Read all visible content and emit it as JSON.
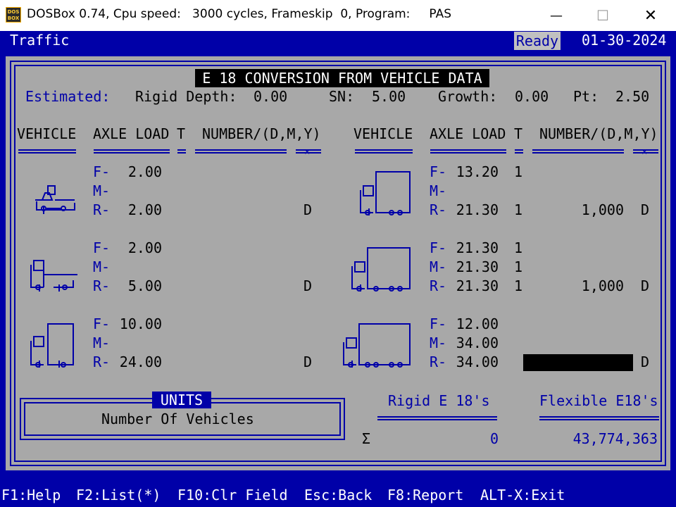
{
  "window": {
    "title": "DOSBox 0.74, Cpu speed:   3000 cycles, Frameskip  0, Program:     PAS",
    "icon_text": "DOS BOX",
    "minimize": "—",
    "maximize": "☐",
    "close": "✕"
  },
  "header": {
    "app": "Traffic",
    "status": "Ready",
    "date": "01-30-2024"
  },
  "panel": {
    "title": "E 18 CONVERSION FROM VEHICLE DATA",
    "estimated_label": "Estimated:",
    "rigid_depth_label": "Rigid Depth:",
    "rigid_depth": "0.00",
    "sn_label": "SN:",
    "sn": "5.00",
    "growth_label": "Growth:",
    "growth": "0.00",
    "pt_label": "Pt:",
    "pt": "2.50"
  },
  "columns": {
    "vehicle": "VEHICLE",
    "axle_load": "AXLE LOAD",
    "t": "T",
    "number": "NUMBER/(D,M,Y)"
  },
  "axle_labels": {
    "f": "F-",
    "m": "M-",
    "r": "R-"
  },
  "vehicles_left": [
    {
      "icon": "car-icon",
      "f": "2.00",
      "f_t": "",
      "m": "",
      "m_t": "",
      "r": "2.00",
      "r_t": "",
      "number": "",
      "period": "D"
    },
    {
      "icon": "pickup-truck-icon",
      "f": "2.00",
      "f_t": "",
      "m": "",
      "m_t": "",
      "r": "5.00",
      "r_t": "",
      "number": "",
      "period": "D"
    },
    {
      "icon": "single-unit-truck-icon",
      "f": "10.00",
      "f_t": "",
      "m": "",
      "m_t": "",
      "r": "24.00",
      "r_t": "",
      "number": "",
      "period": "D"
    }
  ],
  "vehicles_right": [
    {
      "icon": "two-axle-truck-icon",
      "f": "13.20",
      "f_t": "1",
      "m": "",
      "m_t": "",
      "r": "21.30",
      "r_t": "1",
      "number": "1,000",
      "period": "D"
    },
    {
      "icon": "three-axle-truck-icon",
      "f": "21.30",
      "f_t": "1",
      "m": "21.30",
      "m_t": "1",
      "r": "21.30",
      "r_t": "1",
      "number": "1,000",
      "period": "D"
    },
    {
      "icon": "four-axle-truck-icon",
      "f": "12.00",
      "f_t": "",
      "m": "34.00",
      "m_t": "",
      "r": "34.00",
      "r_t": "",
      "number": "",
      "period": "D"
    }
  ],
  "units": {
    "title": "UNITS",
    "value": "Number Of Vehicles"
  },
  "totals": {
    "rigid_label": "Rigid E 18's",
    "flexible_label": "Flexible E18's",
    "sigma": "Σ",
    "rigid_value": "0",
    "flexible_value": "43,774,363"
  },
  "fkeys": {
    "help": "F1:Help",
    "list": "F2:List(*)",
    "clear": "F10:Clr Field",
    "back": "Esc:Back",
    "report": "F8:Report",
    "exit": "ALT-X:Exit"
  },
  "colors": {
    "dos_blue": "#0000a8",
    "panel_gray": "#a8a8a8",
    "white": "#ffffff",
    "black": "#000000"
  }
}
